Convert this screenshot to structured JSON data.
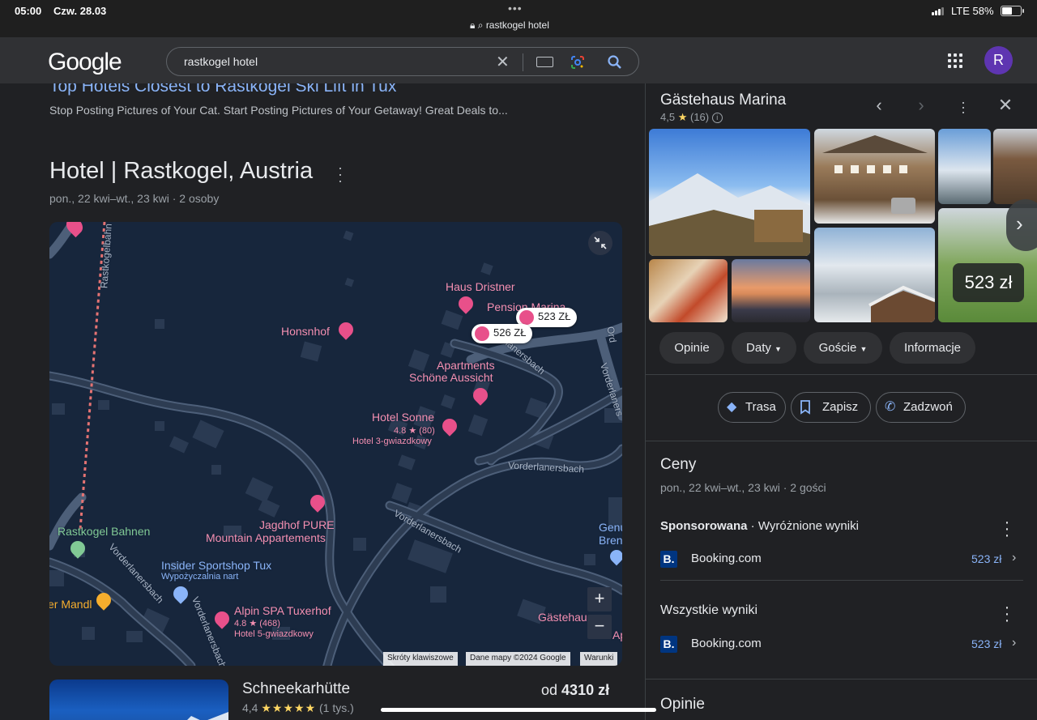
{
  "status_bar": {
    "time": "05:00",
    "date": "Czw. 28.03",
    "url": "rastkogel hotel",
    "network": "LTE 58%",
    "battery_level": 0.58
  },
  "header": {
    "logo": "Google",
    "query": "rastkogel hotel",
    "avatar_letter": "R"
  },
  "ad": {
    "title": "Top Hotels Closest to Rastkogel Ski Lift in Tux",
    "description": "Stop Posting Pictures of Your Cat. Start Posting Pictures of Your Getaway! Great Deals to..."
  },
  "hotels_block": {
    "title": "Hotel | Rastkogel, Austria",
    "subtitle": "pon., 22 kwi–wt., 23 kwi · 2 osoby"
  },
  "map": {
    "labels": {
      "haus_dristner": "Haus Dristner",
      "pension_marina": "Pension Marina",
      "honsnhof": "Honsnhof",
      "apartments_1": "Apartments",
      "apartments_2": "Schöne Aussicht",
      "hotel_sonne": "Hotel Sonne",
      "hotel_sonne_rating": "4.8 ★ (80)",
      "hotel_sonne_class": "Hotel 3-gwiazdkowy",
      "jagdhof_1": "Jagdhof PURE",
      "jagdhof_2": "Mountain Appartements",
      "rastkogel_bahnen": "Rastkogel Bahnen",
      "insider": "Insider Sportshop Tux",
      "insider_sub": "Wypożyczalnia nart",
      "mandl": "er Mandl",
      "alpin_spa": "Alpin SPA Tuxerhof",
      "alpin_spa_rating": "4.8 ★ (468)",
      "alpin_spa_class": "Hotel 5-gwiazdkowy",
      "gastehaus": "Gästehaus",
      "genu": "Genu",
      "bren": "Bren",
      "ap": "Ap",
      "ord": "Ord",
      "road_1": "Vorderlanersbach",
      "road_2": "Vorderlanersbach",
      "road_3": "Vorderlanersbach",
      "road_4": "Vorderlanersbach",
      "road_5": "Vorderlaners",
      "road_6": "Vorderlanersbach",
      "road_7": "lanersbach",
      "rastkogelbahn": "Rastkogelbahn"
    },
    "price_chips": [
      "523 ZŁ",
      "526 ZŁ"
    ],
    "zoom_in": "+",
    "zoom_out": "−",
    "attribution": [
      "Skróty klawiszowe",
      "Dane mapy ©2024 Google",
      "Warunki"
    ]
  },
  "card": {
    "name": "Schneekarhütte",
    "price_prefix": "od",
    "price": "4310 zł",
    "rating": "4,4",
    "stars": "★★★★★",
    "reviews": "(1 tys.)"
  },
  "panel": {
    "title": "Gästehaus Marina",
    "rating": "4,5",
    "reviews": "(16)",
    "photo_price": "523 zł",
    "chips": [
      "Opinie",
      "Daty",
      "Goście",
      "Informacje"
    ],
    "actions": [
      "Trasa",
      "Zapisz",
      "Zadzwoń"
    ],
    "prices": {
      "title": "Ceny",
      "subtitle": "pon., 22 kwi–wt., 23 kwi · 2 gości",
      "sponsored_label": "Sponsorowana",
      "sponsored_rest": "Wyróżnione wyniki",
      "sponsored_provider": "Booking.com",
      "sponsored_price": "523 zł",
      "all_label": "Wszystkie wyniki",
      "all_provider": "Booking.com",
      "all_price": "523 zł"
    },
    "reviews_section": "Opinie"
  },
  "colors": {
    "background": "#202124",
    "link": "#8ab4f8",
    "map_background": "#17263c",
    "pin": "#e8508a",
    "star": "#fdd663"
  }
}
